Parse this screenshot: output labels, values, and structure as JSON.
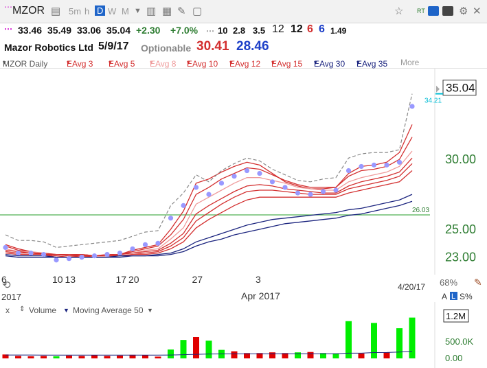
{
  "toolbar": {
    "symbol": "MZOR",
    "timeframes": [
      "5m",
      "h",
      "D",
      "W",
      "M"
    ],
    "active_timeframe": "D",
    "rt_label": "RT"
  },
  "quote": {
    "open": "33.46",
    "high": "35.49",
    "low": "33.06",
    "close": "35.04",
    "change": "+2.30",
    "change_pct": "+7.0%",
    "n1": "10",
    "n2": "2.8",
    "n3": "3.5",
    "n4": "12",
    "n5": "12",
    "n6": "6",
    "n7": "6",
    "n8": "1.49"
  },
  "info": {
    "name": "Mazor Robotics Ltd",
    "date": "5/9/17",
    "optionable": "Optionable",
    "value_red": "30.41",
    "value_blue": "28.46"
  },
  "legend": {
    "items": [
      {
        "label": "MZOR Daily",
        "color": "#555555"
      },
      {
        "label": "EAvg 3",
        "color": "#d32f2f"
      },
      {
        "label": "EAvg 5",
        "color": "#d32f2f"
      },
      {
        "label": "EAvg 8",
        "color": "#ef9a9a"
      },
      {
        "label": "EAvg 10",
        "color": "#d32f2f"
      },
      {
        "label": "EAvg 12",
        "color": "#d32f2f"
      },
      {
        "label": "EAvg 15",
        "color": "#d32f2f"
      },
      {
        "label": "EAvg 30",
        "color": "#1a237e"
      },
      {
        "label": "EAvg 35",
        "color": "#1a237e"
      }
    ],
    "more": "More"
  },
  "bottom": {
    "year": "2017",
    "month": "Apr 2017",
    "end_date": "4/20/17",
    "zoom": "68%",
    "a_label": "A",
    "l_label": "L",
    "s_label": "S%"
  },
  "volume_legend": {
    "x": "x",
    "volume": "Volume",
    "ma": "Moving Average 50"
  },
  "chart_data": [
    {
      "type": "line",
      "x": [
        "6",
        "7",
        "8",
        "9",
        "10",
        "13",
        "14",
        "15",
        "16",
        "17",
        "20",
        "21",
        "22",
        "23",
        "24",
        "27",
        "28",
        "29",
        "30",
        "31",
        "3",
        "4",
        "5",
        "6",
        "7",
        "10",
        "11",
        "12",
        "13",
        "17",
        "18",
        "19",
        "20"
      ],
      "x_tick_labels": [
        "6",
        "13",
        "20",
        "27",
        "3",
        "10",
        "17"
      ],
      "y_tick_labels": [
        "35.04",
        "30.00",
        "25.00",
        "23.00"
      ],
      "ylim": [
        22.0,
        36.5
      ],
      "price_labels": {
        "last": "35.04",
        "cyan": "34.21",
        "green_line": "26.03"
      },
      "series": [
        {
          "name": "MZOR Daily",
          "color": "#9999ff",
          "values": [
            23.7,
            23.3,
            23.3,
            23.2,
            22.8,
            22.9,
            23.0,
            23.1,
            23.2,
            23.3,
            23.6,
            23.9,
            24.0,
            25.8,
            26.7,
            28.0,
            27.5,
            28.3,
            28.8,
            29.2,
            29.0,
            28.4,
            28.0,
            27.6,
            27.5,
            27.7,
            27.8,
            29.2,
            29.5,
            29.6,
            29.6,
            29.8,
            33.8
          ]
        },
        {
          "name": "EAvg 3",
          "color": "#d32f2f",
          "values": [
            23.9,
            23.6,
            23.4,
            23.2,
            23.0,
            23.0,
            23.0,
            23.1,
            23.2,
            23.2,
            23.5,
            23.7,
            23.9,
            25.0,
            26.3,
            28.3,
            28.6,
            29.1,
            29.5,
            29.8,
            29.6,
            29.0,
            28.4,
            28.1,
            27.9,
            27.9,
            28.0,
            29.0,
            29.5,
            29.6,
            29.8,
            30.5,
            32.5
          ]
        },
        {
          "name": "EAvg 5",
          "color": "#d32f2f",
          "values": [
            23.8,
            23.5,
            23.4,
            23.2,
            23.1,
            23.0,
            23.1,
            23.1,
            23.1,
            23.2,
            23.4,
            23.6,
            23.8,
            24.6,
            25.7,
            27.5,
            28.0,
            28.6,
            29.0,
            29.4,
            29.3,
            28.9,
            28.5,
            28.2,
            28.0,
            28.0,
            28.0,
            28.8,
            29.2,
            29.3,
            29.5,
            30.0,
            31.6
          ]
        },
        {
          "name": "EAvg 8",
          "color": "#ef9a9a",
          "values": [
            23.6,
            23.4,
            23.4,
            23.3,
            23.2,
            23.1,
            23.2,
            23.1,
            23.1,
            23.2,
            23.3,
            23.5,
            23.6,
            24.3,
            25.1,
            26.8,
            27.3,
            27.8,
            28.3,
            28.7,
            28.7,
            28.5,
            28.3,
            28.0,
            27.9,
            27.8,
            27.8,
            28.4,
            28.7,
            28.9,
            29.1,
            29.5,
            30.6
          ]
        },
        {
          "name": "EAvg 10",
          "color": "#d32f2f",
          "values": [
            23.5,
            23.4,
            23.3,
            23.3,
            23.2,
            23.2,
            23.2,
            23.1,
            23.1,
            23.2,
            23.3,
            23.4,
            23.5,
            24.0,
            24.7,
            26.1,
            26.7,
            27.2,
            27.7,
            28.1,
            28.2,
            28.1,
            27.9,
            27.8,
            27.7,
            27.6,
            27.6,
            28.1,
            28.4,
            28.6,
            28.8,
            29.1,
            30.1
          ]
        },
        {
          "name": "EAvg 12",
          "color": "#d32f2f",
          "values": [
            23.4,
            23.3,
            23.3,
            23.2,
            23.2,
            23.1,
            23.2,
            23.1,
            23.1,
            23.1,
            23.2,
            23.3,
            23.4,
            23.8,
            24.4,
            25.6,
            26.2,
            26.8,
            27.3,
            27.7,
            27.8,
            27.8,
            27.7,
            27.6,
            27.5,
            27.5,
            27.5,
            27.9,
            28.1,
            28.3,
            28.5,
            28.8,
            29.7
          ]
        },
        {
          "name": "EAvg 15",
          "color": "#d32f2f",
          "values": [
            23.3,
            23.2,
            23.2,
            23.2,
            23.2,
            23.1,
            23.1,
            23.1,
            23.1,
            23.1,
            23.2,
            23.2,
            23.3,
            23.6,
            24.1,
            25.1,
            25.7,
            26.2,
            26.7,
            27.1,
            27.3,
            27.3,
            27.3,
            27.3,
            27.3,
            27.3,
            27.3,
            27.6,
            27.8,
            28.0,
            28.2,
            28.4,
            29.2
          ]
        },
        {
          "name": "EAvg 30",
          "color": "#1a237e",
          "values": [
            23.2,
            23.1,
            23.1,
            23.1,
            23.0,
            23.0,
            23.0,
            23.0,
            23.0,
            23.1,
            23.1,
            23.1,
            23.2,
            23.3,
            23.6,
            24.1,
            24.4,
            24.7,
            25.0,
            25.3,
            25.5,
            25.7,
            25.8,
            25.9,
            26.0,
            26.1,
            26.2,
            26.4,
            26.5,
            26.7,
            26.9,
            27.1,
            27.5
          ]
        },
        {
          "name": "EAvg 35",
          "color": "#1a237e",
          "values": [
            23.1,
            23.0,
            23.0,
            23.0,
            23.0,
            23.0,
            23.0,
            23.0,
            23.0,
            23.0,
            23.1,
            23.1,
            23.1,
            23.2,
            23.4,
            23.8,
            24.1,
            24.3,
            24.6,
            24.8,
            25.0,
            25.2,
            25.4,
            25.5,
            25.6,
            25.7,
            25.8,
            26.0,
            26.1,
            26.3,
            26.5,
            26.7,
            27.0
          ]
        }
      ],
      "reference_line": {
        "y": 26.03,
        "color": "#4caf50"
      }
    },
    {
      "type": "bar",
      "title": "Volume",
      "y_tick_labels": [
        "1.2M",
        "500.0K",
        "0.00"
      ],
      "ylim": [
        0,
        1200000
      ],
      "values": [
        110000,
        70000,
        60000,
        70000,
        60000,
        80000,
        70000,
        90000,
        70000,
        80000,
        100000,
        90000,
        50000,
        250000,
        520000,
        600000,
        500000,
        240000,
        200000,
        150000,
        150000,
        170000,
        150000,
        170000,
        180000,
        150000,
        140000,
        1050000,
        140000,
        1000000,
        170000,
        850000,
        1150000
      ],
      "colors": [
        "red",
        "red",
        "red",
        "red",
        "green",
        "red",
        "red",
        "red",
        "red",
        "red",
        "red",
        "red",
        "red",
        "green",
        "green",
        "red",
        "green",
        "green",
        "red",
        "red",
        "red",
        "red",
        "red",
        "green",
        "red",
        "green",
        "green",
        "green",
        "red",
        "green",
        "red",
        "green",
        "green"
      ],
      "ma_values": [
        95000,
        95000,
        94000,
        93000,
        92000,
        92000,
        91000,
        91000,
        90000,
        90000,
        91000,
        91000,
        90000,
        95000,
        105000,
        115000,
        123000,
        126000,
        128000,
        128000,
        128000,
        129000,
        129000,
        130000,
        131000,
        131000,
        131000,
        148000,
        148000,
        165000,
        166000,
        180000,
        200000
      ]
    }
  ]
}
